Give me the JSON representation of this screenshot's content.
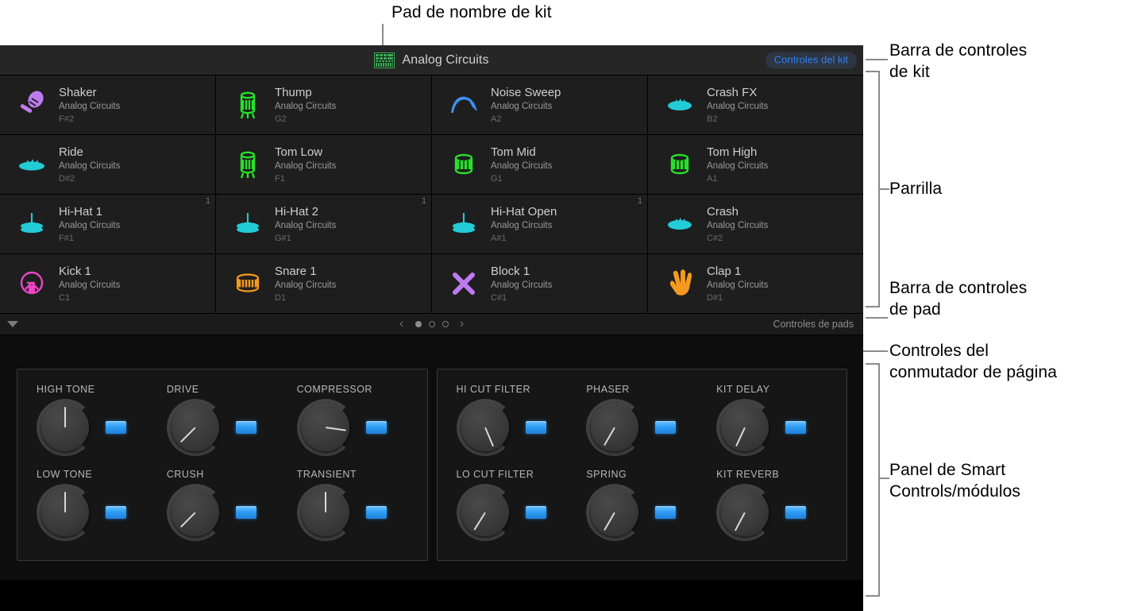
{
  "annotations": [
    {
      "id": "kit-name-pad",
      "text": "Pad de nombre de kit"
    },
    {
      "id": "kit-control-bar",
      "text": "Barra de controles\nde kit"
    },
    {
      "id": "grid",
      "text": "Parrilla"
    },
    {
      "id": "pad-control-bar",
      "text": "Barra de controles\nde pad"
    },
    {
      "id": "page-switcher",
      "text": "Controles del\nconmutador de página"
    },
    {
      "id": "smart-controls",
      "text": "Panel de Smart\nControls/módulos"
    }
  ],
  "kit_bar": {
    "icon": "drum-machine-icon",
    "title": "Analog Circuits",
    "kit_controls_label": "Controles del kit",
    "accent_color": "#2f82f5",
    "icon_color": "#3fa85a"
  },
  "grid": {
    "pads": [
      {
        "name": "Shaker",
        "kit": "Analog Circuits",
        "note": "F#2",
        "badge": "",
        "icon": "shaker-icon",
        "color": "#c07af0"
      },
      {
        "name": "Thump",
        "kit": "Analog Circuits",
        "note": "G2",
        "badge": "",
        "icon": "tom-tall-icon",
        "color": "#27e02a"
      },
      {
        "name": "Noise Sweep",
        "kit": "Analog Circuits",
        "note": "A2",
        "badge": "",
        "icon": "noise-sweep-icon",
        "color": "#3f8ff0"
      },
      {
        "name": "Crash FX",
        "kit": "Analog Circuits",
        "note": "B2",
        "badge": "",
        "icon": "crash-flat-icon",
        "color": "#22ccd6"
      },
      {
        "name": "Ride",
        "kit": "Analog Circuits",
        "note": "D#2",
        "badge": "",
        "icon": "ride-icon",
        "color": "#22ccd6"
      },
      {
        "name": "Tom Low",
        "kit": "Analog Circuits",
        "note": "F1",
        "badge": "",
        "icon": "tom-tall-icon",
        "color": "#27e02a"
      },
      {
        "name": "Tom Mid",
        "kit": "Analog Circuits",
        "note": "G1",
        "badge": "",
        "icon": "tom-icon",
        "color": "#27e02a"
      },
      {
        "name": "Tom High",
        "kit": "Analog Circuits",
        "note": "A1",
        "badge": "",
        "icon": "tom-icon",
        "color": "#27e02a"
      },
      {
        "name": "Hi-Hat 1",
        "kit": "Analog Circuits",
        "note": "F#1",
        "badge": "1",
        "icon": "hihat-icon",
        "color": "#22ccd6"
      },
      {
        "name": "Hi-Hat 2",
        "kit": "Analog Circuits",
        "note": "G#1",
        "badge": "1",
        "icon": "hihat-icon",
        "color": "#22ccd6"
      },
      {
        "name": "Hi-Hat Open",
        "kit": "Analog Circuits",
        "note": "A#1",
        "badge": "1",
        "icon": "hihat-icon",
        "color": "#22ccd6"
      },
      {
        "name": "Crash",
        "kit": "Analog Circuits",
        "note": "C#2",
        "badge": "",
        "icon": "crash-flat-icon",
        "color": "#22ccd6"
      },
      {
        "name": "Kick 1",
        "kit": "Analog Circuits",
        "note": "C1",
        "badge": "",
        "icon": "kick-icon",
        "color": "#ef43c8"
      },
      {
        "name": "Snare 1",
        "kit": "Analog Circuits",
        "note": "D1",
        "badge": "",
        "icon": "snare-icon",
        "color": "#f59a1e"
      },
      {
        "name": "Block 1",
        "kit": "Analog Circuits",
        "note": "C#1",
        "badge": "",
        "icon": "sticks-icon",
        "color": "#c07af0"
      },
      {
        "name": "Clap 1",
        "kit": "Analog Circuits",
        "note": "D#1",
        "badge": "",
        "icon": "clap-hand-icon",
        "color": "#f59a1e"
      }
    ]
  },
  "pad_bar": {
    "disclosure": "disclosure-triangle-icon",
    "prev": "‹",
    "next": "›",
    "pages": 3,
    "active_page": 1,
    "pad_controls_label": "Controles de pads"
  },
  "smart_controls": {
    "modules": [
      {
        "controls": [
          {
            "label": "HIGH TONE",
            "angle": 0,
            "led_on": true
          },
          {
            "label": "DRIVE",
            "angle": -135,
            "led_on": true
          },
          {
            "label": "COMPRESSOR",
            "angle": 98,
            "led_on": true
          },
          {
            "label": "LOW TONE",
            "angle": 0,
            "led_on": true
          },
          {
            "label": "CRUSH",
            "angle": -135,
            "led_on": true
          },
          {
            "label": "TRANSIENT",
            "angle": 0,
            "led_on": true
          }
        ]
      },
      {
        "controls": [
          {
            "label": "HI CUT FILTER",
            "angle": 157,
            "led_on": true
          },
          {
            "label": "PHASER",
            "angle": -150,
            "led_on": true
          },
          {
            "label": "KIT DELAY",
            "angle": -155,
            "led_on": true
          },
          {
            "label": "LO CUT FILTER",
            "angle": -148,
            "led_on": true
          },
          {
            "label": "SPRING",
            "angle": -150,
            "led_on": true
          },
          {
            "label": "KIT REVERB",
            "angle": -152,
            "led_on": true
          }
        ]
      }
    ]
  }
}
